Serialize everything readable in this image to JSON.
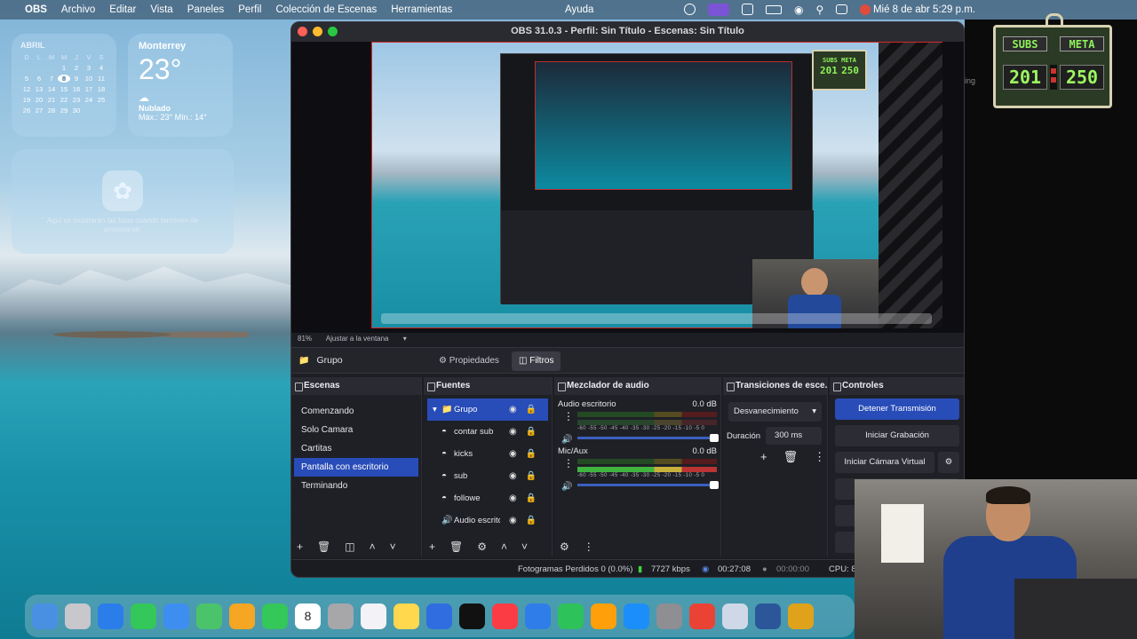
{
  "menubar": {
    "app": "OBS",
    "items": [
      "Archivo",
      "Editar",
      "Vista",
      "Paneles",
      "Perfil",
      "Colección de Escenas",
      "Herramientas"
    ],
    "help": "Ayuda",
    "clock": "Mié 8 de abr  5:29 p.m."
  },
  "calendar": {
    "month": "ABRIL",
    "weekdays": [
      "D",
      "L",
      "M",
      "M",
      "J",
      "V",
      "S"
    ],
    "days": [
      "",
      "",
      "",
      "1",
      "2",
      "3",
      "4",
      "5",
      "6",
      "7",
      "8",
      "9",
      "10",
      "11",
      "12",
      "13",
      "14",
      "15",
      "16",
      "17",
      "18",
      "19",
      "20",
      "21",
      "22",
      "23",
      "24",
      "25",
      "26",
      "27",
      "28",
      "29",
      "30",
      "",
      ""
    ],
    "today": "8"
  },
  "weather": {
    "city": "Monterrey",
    "temp": "23°",
    "condition": "Nublado",
    "minmax": "Máx.: 23° Mín.: 14°"
  },
  "photos_widget": {
    "message": "Aquí se mostrarán las fotos cuando terminen de procesarse."
  },
  "subs_widget": {
    "subs_label": "SUBS",
    "meta_label": "META",
    "subs_value": "201",
    "meta_value": "250"
  },
  "obs": {
    "title": "OBS 31.0.3 - Perfil: Sin Título - Escenas: Sin Título",
    "zoom": "81%",
    "fit": "Ajustar a la ventana",
    "group_label": "Grupo",
    "tabs": {
      "props": "Propiedades",
      "filters": "Filtros"
    },
    "scenes_title": "Escenas",
    "scenes": [
      "Comenzando",
      "Solo Camara",
      "Cartitas",
      "Pantalla con escritorio",
      "Terminando"
    ],
    "selected_scene": 3,
    "sources_title": "Fuentes",
    "sources": [
      {
        "name": "Grupo",
        "icon": "folder-icon"
      },
      {
        "name": "contar sub",
        "icon": "browser-icon"
      },
      {
        "name": "kicks",
        "icon": "browser-icon"
      },
      {
        "name": "sub",
        "icon": "browser-icon"
      },
      {
        "name": "followe",
        "icon": "browser-icon"
      },
      {
        "name": "Audio escrito",
        "icon": "speaker-icon"
      }
    ],
    "mixer_title": "Mezclador de audio",
    "mixer": [
      {
        "name": "Audio escritorio",
        "db": "0.0 dB",
        "level": 0.0
      },
      {
        "name": "Mic/Aux",
        "db": "0.0 dB",
        "level": 0.78
      }
    ],
    "mixer_scale": "-60 -55 -50 -45 -40 -35 -30 -25 -20 -15 -10 -5 0",
    "transitions_title": "Transiciones de esce...",
    "transition": "Desvanecimiento",
    "duration_label": "Duración",
    "duration_value": "300 ms",
    "controls_title": "Controles",
    "controls": {
      "stop_stream": "Detener Transmisión",
      "start_record": "Iniciar Grabación",
      "virtual_cam": "Iniciar Cámara Virtual"
    },
    "status": {
      "dropped": "Fotogramas Perdidos 0 (0.0%)",
      "bitrate": "7727 kbps",
      "stream_time": "00:27:08",
      "rec_time": "00:00:00",
      "cpu": "CPU: 8."
    }
  },
  "mini_subs": {
    "a": "SUBS",
    "b": "META",
    "c": "201",
    "d": "250"
  },
  "overflow_text": "ing",
  "dock_apps": [
    "finder-icon",
    "launchpad-icon",
    "safari-icon",
    "messages-icon",
    "mail-icon",
    "maps-icon",
    "photos-icon",
    "facetime-icon",
    "calendar-icon",
    "contacts-icon",
    "reminders-icon",
    "notes-icon",
    "freeform-icon",
    "tv-icon",
    "music-icon",
    "keynote-icon",
    "numbers-icon",
    "pages-icon",
    "appstore-icon",
    "settings-icon",
    "gmail-icon",
    "obs-icon",
    "word-icon",
    "rider-icon"
  ],
  "dock_calendar_day": "8",
  "colors": {
    "accent": "#284cb8",
    "red_border": "#d62828"
  }
}
